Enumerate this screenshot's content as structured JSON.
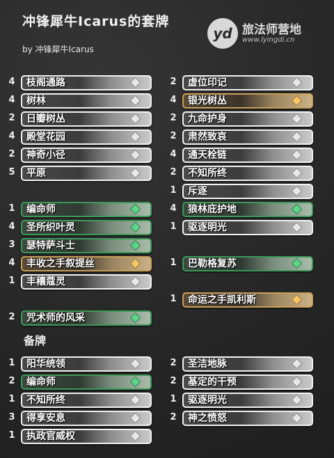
{
  "header": {
    "title": "冲锋犀牛Icarus的套牌",
    "byline": "by 冲锋犀牛Icarus"
  },
  "logo": {
    "mark": "yd",
    "name": "旅法师营地",
    "url": "www.lyingdi.cn"
  },
  "deck": {
    "left": [
      {
        "count": "4",
        "name": "枝阁通路",
        "rarity": "common"
      },
      {
        "count": "4",
        "name": "树林",
        "rarity": "common"
      },
      {
        "count": "2",
        "name": "日瓣树丛",
        "rarity": "common"
      },
      {
        "count": "4",
        "name": "殿堂花园",
        "rarity": "common"
      },
      {
        "count": "2",
        "name": "神奇小径",
        "rarity": "common"
      },
      {
        "count": "5",
        "name": "平原",
        "rarity": "common"
      },
      {
        "count": "1",
        "name": "编命师",
        "rarity": "green"
      },
      {
        "count": "4",
        "name": "圣所织叶灵",
        "rarity": "green"
      },
      {
        "count": "3",
        "name": "瑟特萨斗士",
        "rarity": "green"
      },
      {
        "count": "4",
        "name": "丰收之手叙提丝",
        "rarity": "gold"
      },
      {
        "count": "1",
        "name": "丰穰蔻灵",
        "rarity": "common"
      },
      {
        "count": "2",
        "name": "咒术师的风采",
        "rarity": "green"
      }
    ],
    "right": [
      {
        "count": "2",
        "name": "虚位印记",
        "rarity": "common"
      },
      {
        "count": "4",
        "name": "银光树丛",
        "rarity": "gold"
      },
      {
        "count": "2",
        "name": "九命护身",
        "rarity": "common"
      },
      {
        "count": "2",
        "name": "肃然致哀",
        "rarity": "common"
      },
      {
        "count": "4",
        "name": "通天栓链",
        "rarity": "common"
      },
      {
        "count": "2",
        "name": "不知所终",
        "rarity": "common"
      },
      {
        "count": "1",
        "name": "斥逐",
        "rarity": "common"
      },
      {
        "count": "4",
        "name": "狼林庇护地",
        "rarity": "green"
      },
      {
        "count": "1",
        "name": "驱逐明光",
        "rarity": "common"
      },
      {
        "count": "1",
        "name": "巴勒格复苏",
        "rarity": "green"
      },
      {
        "count": "1",
        "name": "命运之手凯利斯",
        "rarity": "gold"
      }
    ]
  },
  "sideboard": {
    "label": "备牌",
    "left": [
      {
        "count": "1",
        "name": "阳华统领",
        "rarity": "common"
      },
      {
        "count": "2",
        "name": "编命师",
        "rarity": "green"
      },
      {
        "count": "1",
        "name": "不知所终",
        "rarity": "common"
      },
      {
        "count": "3",
        "name": "得享安息",
        "rarity": "common"
      },
      {
        "count": "1",
        "name": "执政官威权",
        "rarity": "common"
      }
    ],
    "right": [
      {
        "count": "2",
        "name": "圣洁地脉",
        "rarity": "common"
      },
      {
        "count": "2",
        "name": "基定的干预",
        "rarity": "common"
      },
      {
        "count": "1",
        "name": "驱逐明光",
        "rarity": "common"
      },
      {
        "count": "2",
        "name": "神之愤怒",
        "rarity": "common"
      }
    ]
  }
}
